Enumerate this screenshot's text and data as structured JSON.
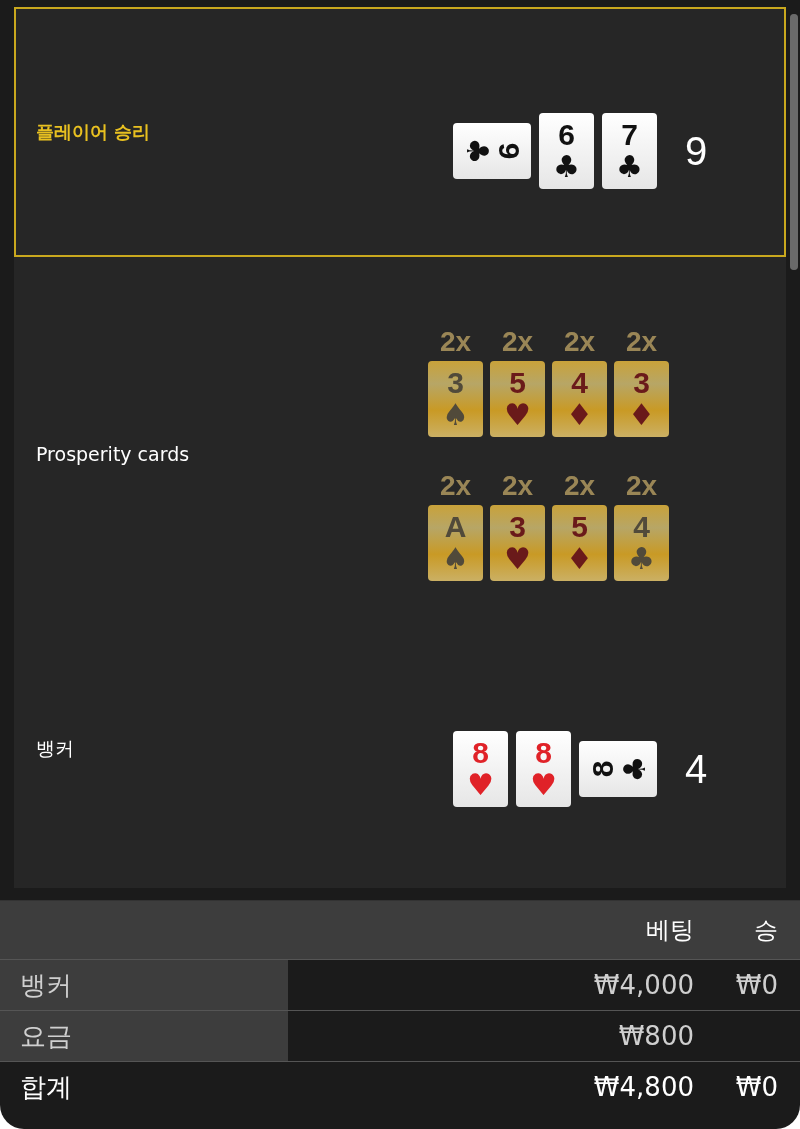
{
  "player": {
    "label": "플레이어 승리",
    "winner": true,
    "cards": [
      {
        "rank": "9",
        "suit": "♣",
        "red": false,
        "turned_right": true,
        "turned_left": false
      },
      {
        "rank": "6",
        "suit": "♣",
        "red": false,
        "turned_right": false,
        "turned_left": false
      },
      {
        "rank": "7",
        "suit": "♣",
        "red": false,
        "turned_right": false,
        "turned_left": false
      }
    ],
    "score": "9"
  },
  "prosperity": {
    "label": "Prosperity cards",
    "rows": [
      [
        {
          "multiplier": "2x",
          "rank": "3",
          "suit": "♠",
          "red": false
        },
        {
          "multiplier": "2x",
          "rank": "5",
          "suit": "♥",
          "red": true
        },
        {
          "multiplier": "2x",
          "rank": "4",
          "suit": "♦",
          "red": true
        },
        {
          "multiplier": "2x",
          "rank": "3",
          "suit": "♦",
          "red": true
        }
      ],
      [
        {
          "multiplier": "2x",
          "rank": "A",
          "suit": "♠",
          "red": false
        },
        {
          "multiplier": "2x",
          "rank": "3",
          "suit": "♥",
          "red": true
        },
        {
          "multiplier": "2x",
          "rank": "5",
          "suit": "♦",
          "red": true
        },
        {
          "multiplier": "2x",
          "rank": "4",
          "suit": "♣",
          "red": false
        }
      ]
    ]
  },
  "banker": {
    "label": "뱅커",
    "winner": false,
    "cards": [
      {
        "rank": "8",
        "suit": "♥",
        "red": true,
        "turned_right": false,
        "turned_left": false
      },
      {
        "rank": "8",
        "suit": "♥",
        "red": true,
        "turned_right": false,
        "turned_left": false
      },
      {
        "rank": "8",
        "suit": "♣",
        "red": false,
        "turned_right": false,
        "turned_left": true
      }
    ],
    "score": "4"
  },
  "table": {
    "columns": [
      "베팅",
      "승"
    ],
    "rows": [
      {
        "kind": "bet",
        "label": "뱅커",
        "bet": "₩4,000",
        "win": "₩0"
      },
      {
        "kind": "bet",
        "label": "요금",
        "bet": "₩800"
      },
      {
        "kind": "total",
        "label": "합계",
        "bet": "₩4,800",
        "win": "₩0"
      }
    ]
  }
}
